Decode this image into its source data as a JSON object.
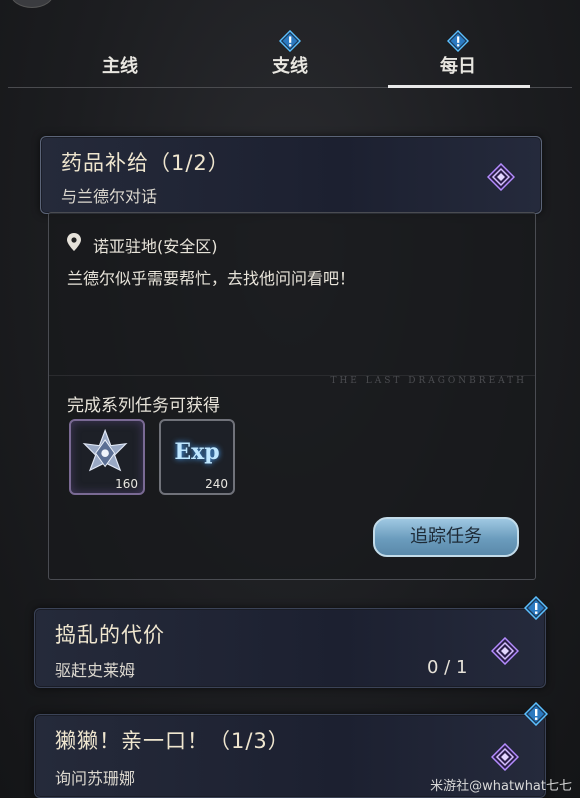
{
  "tabs": [
    {
      "label": "主线"
    },
    {
      "label": "支线"
    },
    {
      "label": "每日"
    }
  ],
  "active_tab": "每日",
  "quests": [
    {
      "title": "药品补给（1/2）",
      "subtitle": "与兰德尔对话",
      "progress": ""
    },
    {
      "title": "捣乱的代价",
      "subtitle": "驱赶史莱姆",
      "progress": "0 / 1"
    },
    {
      "title": "獭獭！亲一口！（1/3）",
      "subtitle": "询问苏珊娜",
      "progress": ""
    }
  ],
  "detail": {
    "location": "诺亚驻地(安全区)",
    "description": "兰德尔似乎需要帮忙，去找他问问看吧！",
    "banner": "THE LAST DRAGONBREATH",
    "reward_heading": "完成系列任务可获得",
    "rewards": [
      {
        "icon": "medal-icon",
        "count": "160"
      },
      {
        "icon": "exp-icon",
        "label": "Exp",
        "count": "240"
      }
    ],
    "track_button": "追踪任务"
  },
  "credit": "米游社@whatwhat七七",
  "colors": {
    "accent_diamond": "#b58cff",
    "alert_blue": "#4fb4ff",
    "button": "#7fb0cf"
  }
}
